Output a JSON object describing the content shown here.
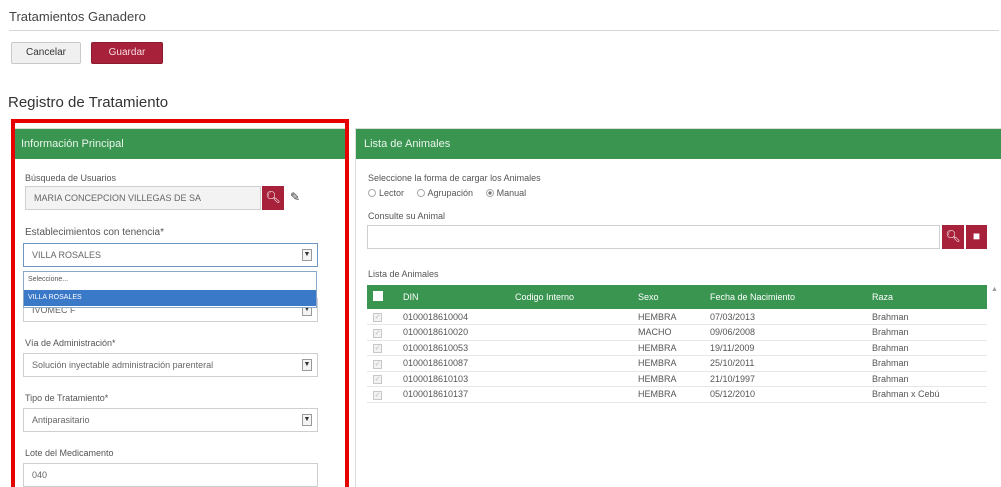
{
  "window": {
    "title": "Tratamientos Ganadero"
  },
  "toolbar": {
    "cancel_label": "Cancelar",
    "save_label": "Guardar"
  },
  "section_title": "Registro de Tratamiento",
  "left_panel": {
    "header": "Información Principal",
    "user_search": {
      "label": "Búsqueda de Usuarios",
      "value": "MARIA CONCEPCION VILLEGAS DE SA"
    },
    "establishments": {
      "label": "Establecimientos con tenencia*",
      "selected": "VILLA ROSALES",
      "options": [
        "Seleccione...",
        "VILLA ROSALES"
      ],
      "behind_value": "IVOMEC F"
    },
    "route": {
      "label": "Vía de Administración*",
      "selected": "Solución inyectable administración parenteral"
    },
    "treatment_type": {
      "label": "Tipo de Tratamiento*",
      "selected": "Antiparasitario"
    },
    "batch": {
      "label": "Lote del Medicamento",
      "value": "040"
    }
  },
  "right_panel": {
    "header": "Lista de Animales",
    "load_method": {
      "label": "Seleccione la forma de cargar los Animales",
      "options": [
        "Lector",
        "Agrupación",
        "Manual"
      ],
      "selected": "Manual"
    },
    "query": {
      "label": "Consulte su Animal",
      "value": ""
    },
    "table": {
      "label": "Lista de Animales",
      "columns": [
        "DIN",
        "Codigo Interno",
        "Sexo",
        "Fecha de Nacimiento",
        "Raza"
      ],
      "rows": [
        [
          "0100018610004",
          "",
          "HEMBRA",
          "07/03/2013",
          "Brahman"
        ],
        [
          "0100018610020",
          "",
          "MACHO",
          "09/06/2008",
          "Brahman"
        ],
        [
          "0100018610053",
          "",
          "HEMBRA",
          "19/11/2009",
          "Brahman"
        ],
        [
          "0100018610087",
          "",
          "HEMBRA",
          "25/10/2011",
          "Brahman"
        ],
        [
          "0100018610103",
          "",
          "HEMBRA",
          "21/10/1997",
          "Brahman"
        ],
        [
          "0100018610137",
          "",
          "HEMBRA",
          "05/12/2010",
          "Brahman x Cebú"
        ]
      ]
    }
  },
  "colors": {
    "header_green": "#3a9551",
    "accent_red": "#a8213a",
    "highlight": "#e60000",
    "selection_blue": "#3a78c8"
  }
}
